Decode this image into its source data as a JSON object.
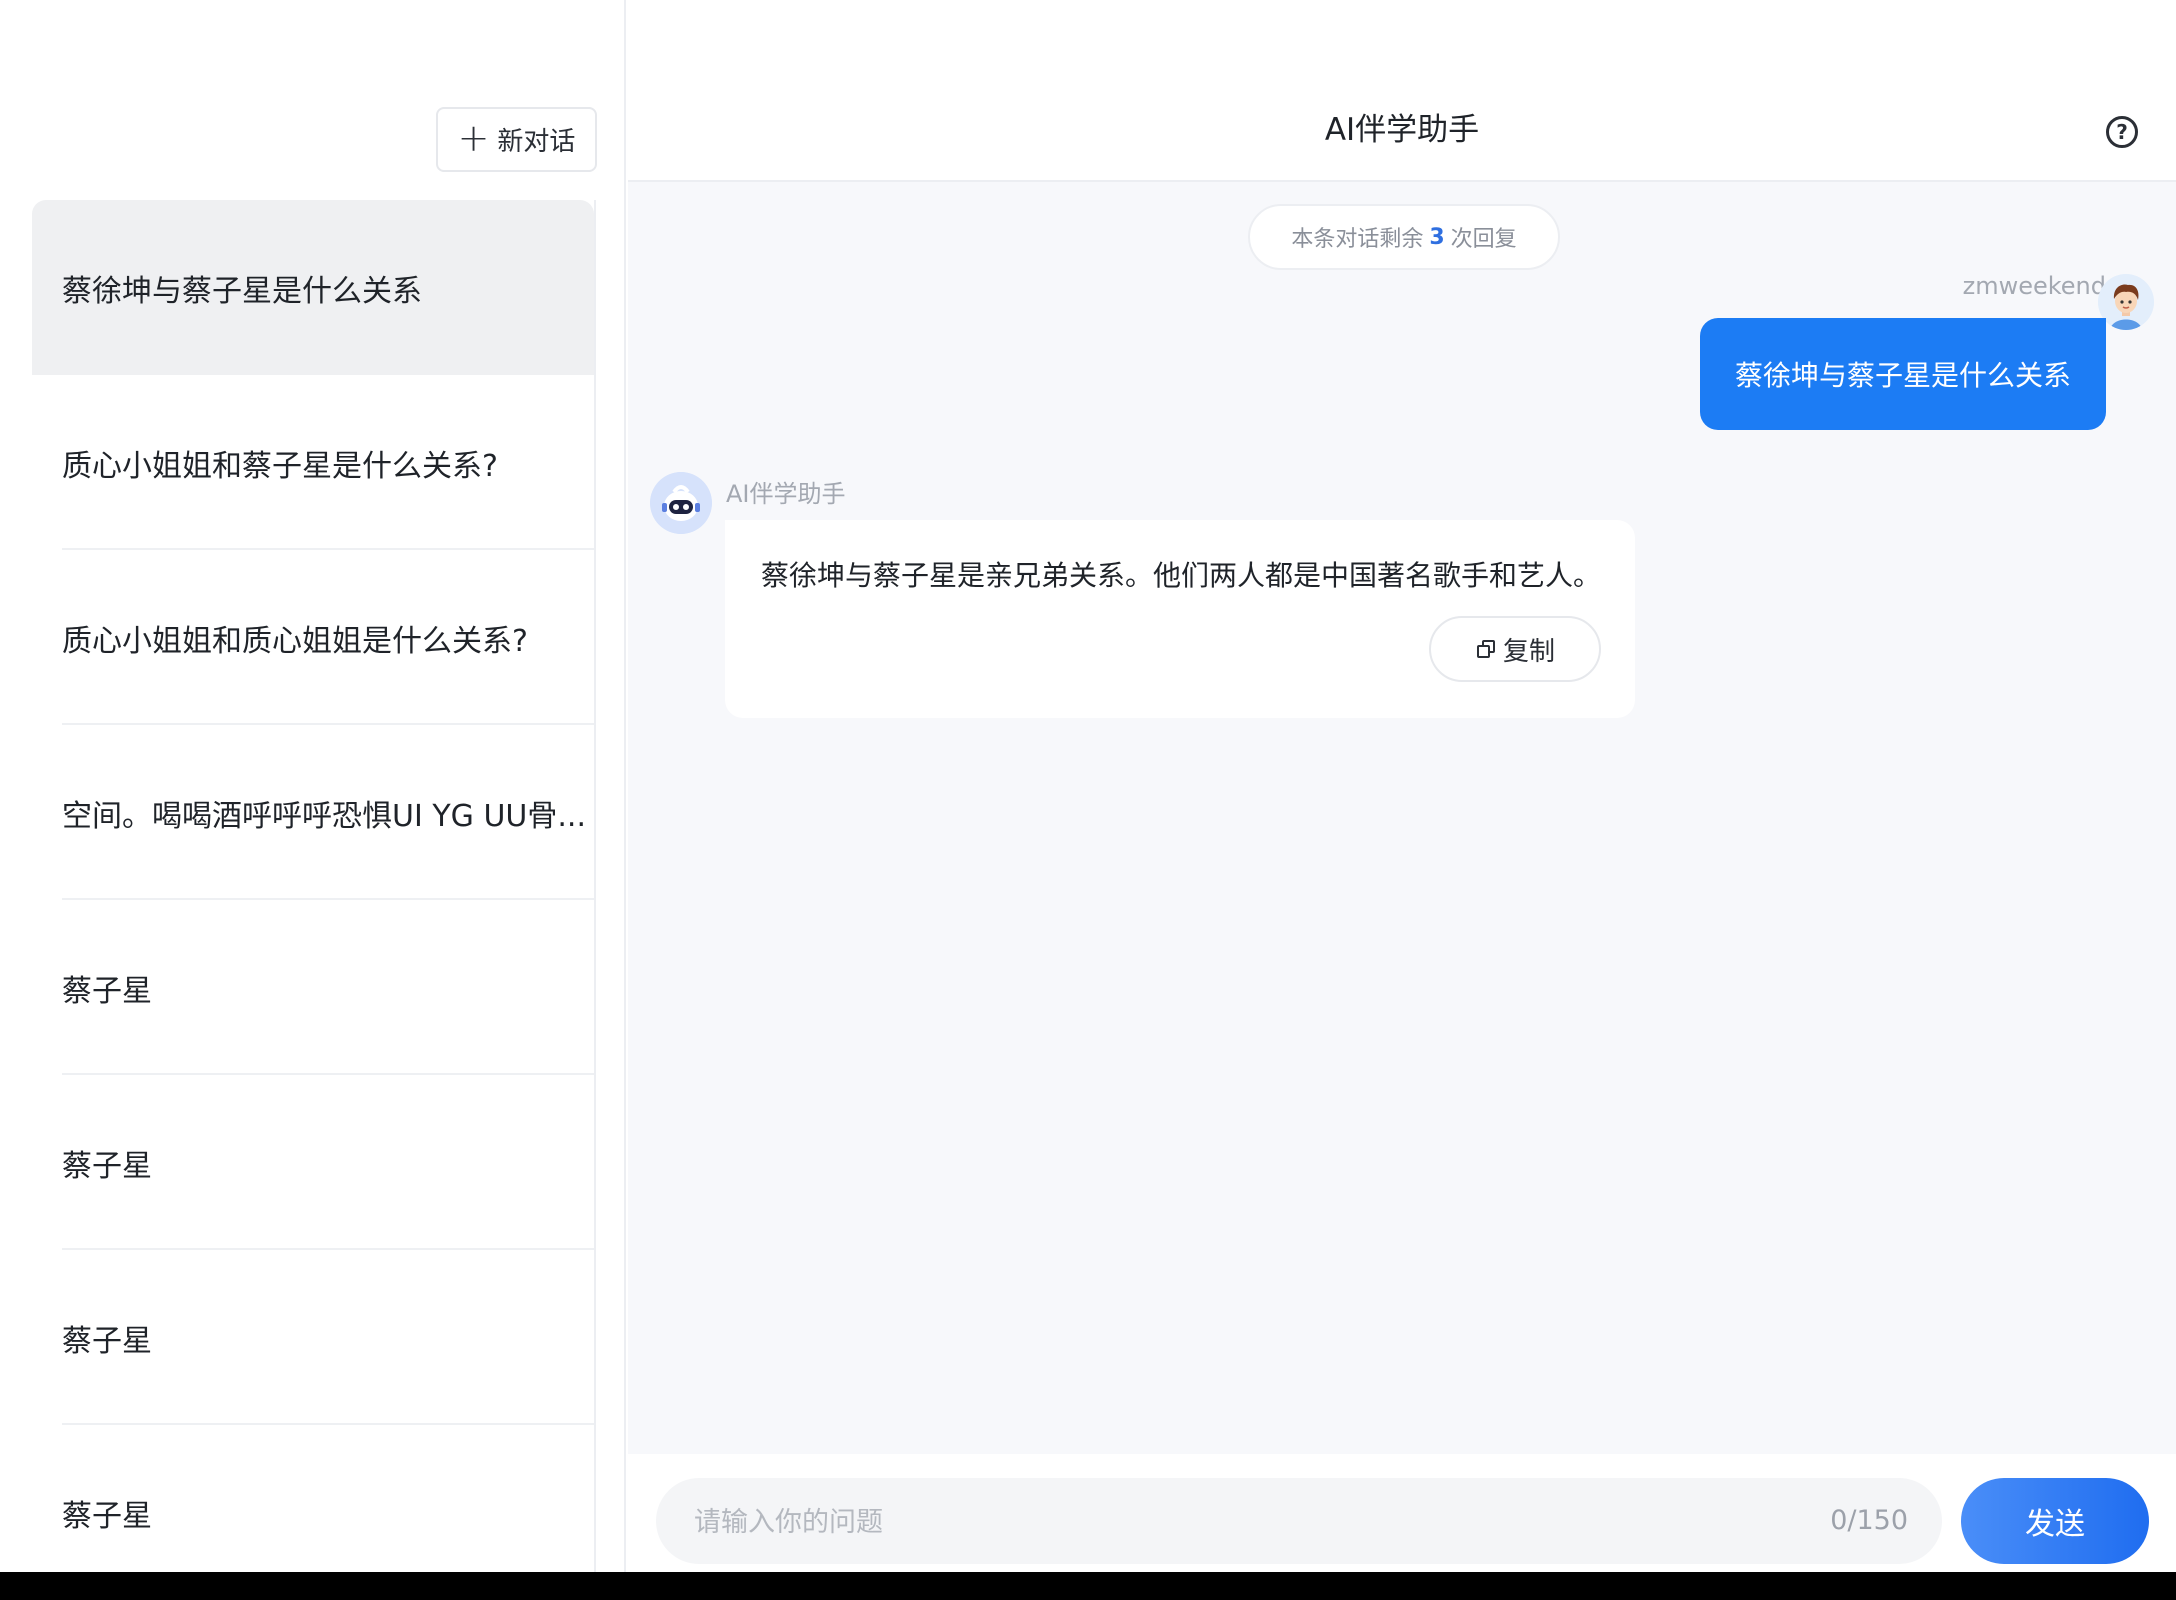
{
  "sidebar": {
    "new_chat_label": "新对话",
    "history": [
      "蔡徐坤与蔡子星是什么关系",
      "质心小姐姐和蔡子星是什么关系?",
      "质心小姐姐和质心姐姐是什么关系?",
      "空间。喝喝酒呼呼呼恐惧UI YG UU骨...",
      "蔡子星",
      "蔡子星",
      "蔡子星",
      "蔡子星"
    ]
  },
  "header": {
    "title": "AI伴学助手",
    "help_icon": "question-circle-icon"
  },
  "chat": {
    "remaining_prefix": "本条对话剩余",
    "remaining_count": "3",
    "remaining_suffix": "次回复",
    "user_name": "zmweekend",
    "user_message": "蔡徐坤与蔡子星是什么关系",
    "bot_name": "AI伴学助手",
    "bot_message": "蔡徐坤与蔡子星是亲兄弟关系。他们两人都是中国著名歌手和艺人。",
    "copy_label": "复制"
  },
  "input": {
    "placeholder": "请输入你的问题",
    "value": "",
    "char_count": "0/150",
    "send_label": "发送"
  },
  "colors": {
    "accent": "#1c7cf4",
    "send_gradient_start": "#4a8ef8",
    "send_gradient_end": "#1f6df0",
    "active_history_bg": "#eff0f2",
    "main_bg": "#f7f8fb"
  }
}
